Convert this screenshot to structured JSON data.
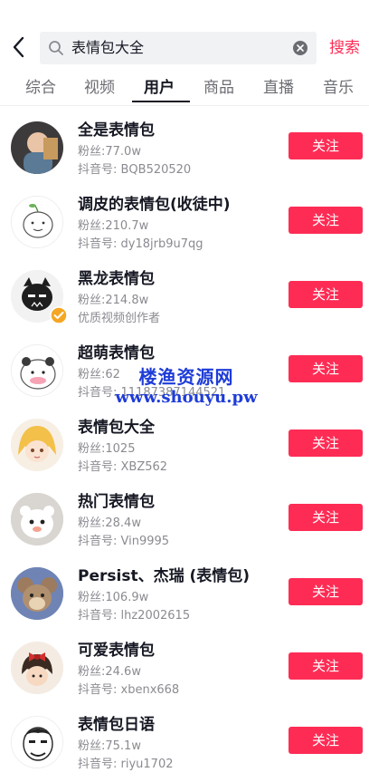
{
  "search": {
    "query": "表情包大全",
    "button_label": "搜索"
  },
  "tabs": [
    {
      "label": "综合"
    },
    {
      "label": "视频"
    },
    {
      "label": "用户",
      "active": true
    },
    {
      "label": "商品"
    },
    {
      "label": "直播"
    },
    {
      "label": "音乐"
    }
  ],
  "users": [
    {
      "name": "全是表情包",
      "fans": "粉丝:77.0w",
      "subtitle": "抖音号: BQB520520",
      "follow_label": "关注"
    },
    {
      "name": "调皮的表情包(收徒中)",
      "fans": "粉丝:210.7w",
      "subtitle": "抖音号: dy18jrb9u7qg",
      "follow_label": "关注"
    },
    {
      "name": "黑龙表情包",
      "fans": "粉丝:214.8w",
      "subtitle": "优质视频创作者",
      "follow_label": "关注",
      "verified": true
    },
    {
      "name": "超萌表情包",
      "fans": "粉丝:62",
      "subtitle": "抖音号: 11187387144521",
      "follow_label": "关注"
    },
    {
      "name": "表情包大全",
      "fans": "粉丝:1025",
      "subtitle": "抖音号: XBZ562",
      "follow_label": "关注"
    },
    {
      "name": "热门表情包",
      "fans": "粉丝:28.4w",
      "subtitle": "抖音号: Vin9995",
      "follow_label": "关注"
    },
    {
      "name": "Persist、杰瑞 (表情包)",
      "fans": "粉丝:106.9w",
      "subtitle": "抖音号: lhz2002615",
      "follow_label": "关注"
    },
    {
      "name": "可爱表情包",
      "fans": "粉丝:24.6w",
      "subtitle": "抖音号: xbenx668",
      "follow_label": "关注"
    },
    {
      "name": "表情包日语",
      "fans": "粉丝:75.1w",
      "subtitle": "抖音号: riyu1702",
      "follow_label": "关注"
    }
  ],
  "watermark": {
    "line1": "楼渔资源网",
    "line2": "www.shouyu.pw"
  },
  "colors": {
    "accent": "#fe2c55",
    "text": "#161823",
    "muted": "#8a8b91",
    "watermark": "#1e3cd8",
    "verified": "#f5a623"
  },
  "icons": {
    "back": "chevron-left-icon",
    "search": "search-icon",
    "clear": "clear-icon",
    "verified": "verified-badge-icon"
  }
}
